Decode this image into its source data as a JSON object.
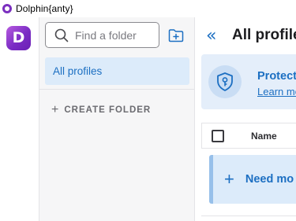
{
  "window": {
    "title": "Dolphin{anty}"
  },
  "rail": {
    "logo_letter": "D",
    "logo_colors": [
      "#b85be0",
      "#7a2cc4"
    ]
  },
  "folders_panel": {
    "search": {
      "placeholder": "Find a folder",
      "value": ""
    },
    "add_folder_icon": "folder-plus-icon",
    "items": [
      {
        "label": "All profiles",
        "selected": true
      }
    ],
    "create_folder_label": "CREATE FOLDER"
  },
  "main": {
    "collapse_icon": "double-chevron-left-icon",
    "title": "All profiles",
    "banner": {
      "icon": "shield-key-icon",
      "title": "Protect",
      "link": "Learn mo"
    },
    "table": {
      "columns": [
        "Name"
      ]
    },
    "promo": {
      "text": "Need mo"
    }
  },
  "colors": {
    "accent": "#1c6fc2",
    "selected_bg": "#dcebfa",
    "panel_bg": "#f6f6f7"
  }
}
